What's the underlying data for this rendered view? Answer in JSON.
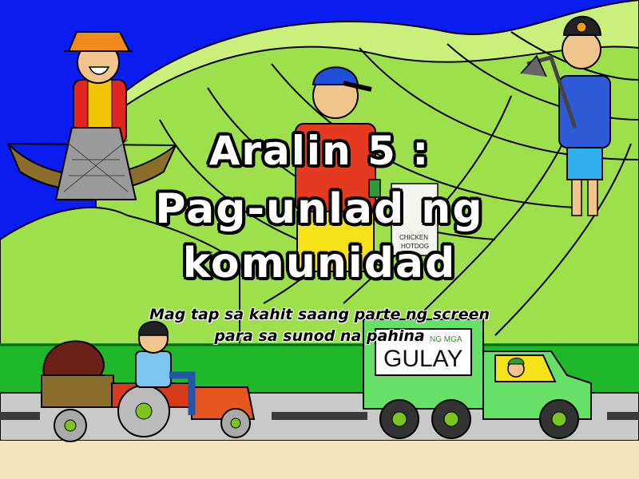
{
  "title": {
    "line1": "Aralin 5 :",
    "line2": "Pag-unlad ng",
    "line3": "komunidad"
  },
  "instruction": {
    "line1": "Mag tap sa kahit saang parte ng screen",
    "line2": "para sa sunod na pahina"
  },
  "truck": {
    "top_label": "NG MGA",
    "label": "GULAY"
  },
  "vendor_sign": {
    "line1": "CHICKEN",
    "line2": "HOTDOG"
  },
  "colors": {
    "sky": "#0000ff",
    "hills": "#bfe66b",
    "field": "#22c322",
    "road": "#c8c8c8",
    "truck": "#66e066"
  }
}
